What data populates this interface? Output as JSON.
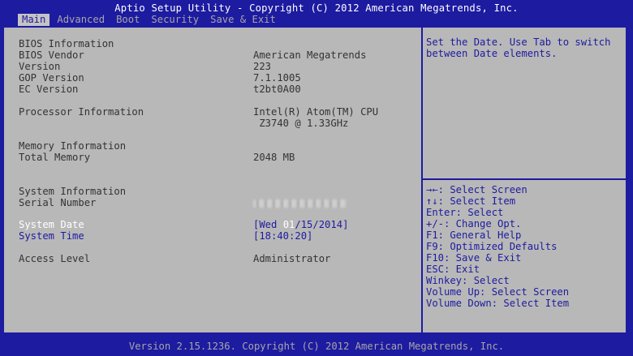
{
  "title": "Aptio Setup Utility - Copyright (C) 2012 American Megatrends, Inc.",
  "menu": [
    {
      "label": "Main",
      "active": true
    },
    {
      "label": "Advanced",
      "active": false
    },
    {
      "label": "Boot",
      "active": false
    },
    {
      "label": "Security",
      "active": false
    },
    {
      "label": "Save & Exit",
      "active": false
    }
  ],
  "main": {
    "bios_info_heading": "BIOS Information",
    "bios_vendor_label": "BIOS Vendor",
    "bios_vendor_value": "American Megatrends",
    "version_label": "Version",
    "version_value": "223",
    "gop_label": "GOP Version",
    "gop_value": "7.1.1005",
    "ec_label": "EC Version",
    "ec_value": "t2bt0A00",
    "processor_label": "Processor Information",
    "processor_value_1": "Intel(R) Atom(TM) CPU",
    "processor_value_2": " Z3740 @ 1.33GHz",
    "memory_heading": "Memory Information",
    "total_memory_label": "Total Memory",
    "total_memory_value": "2048 MB",
    "system_info_heading": "System Information",
    "serial_label": "Serial Number",
    "system_date_label": "System Date",
    "system_date_prefix": "[Wed ",
    "system_date_cursor": "01",
    "system_date_suffix": "/15/2014]",
    "system_time_label": "System Time",
    "system_time_value": "[18:40:20]",
    "access_label": "Access Level",
    "access_value": "Administrator"
  },
  "help": {
    "text": "Set the Date. Use Tab to switch between Date elements."
  },
  "keys": [
    "→←: Select Screen",
    "↑↓: Select Item",
    "Enter: Select",
    "+/-: Change Opt.",
    "F1: General Help",
    "F9: Optimized Defaults",
    "F10: Save & Exit",
    "ESC: Exit",
    "Winkey: Select",
    "Volume Up: Select Screen",
    "Volume Down: Select Item"
  ],
  "footer": {
    "version": "Version 2.15.1236. Copyright (C) 2012 American Megatrends, Inc."
  },
  "colors": {
    "background": "#1d1ba0",
    "panel": "#b8b8b8",
    "menu_active_bg": "#c4c4c4"
  }
}
